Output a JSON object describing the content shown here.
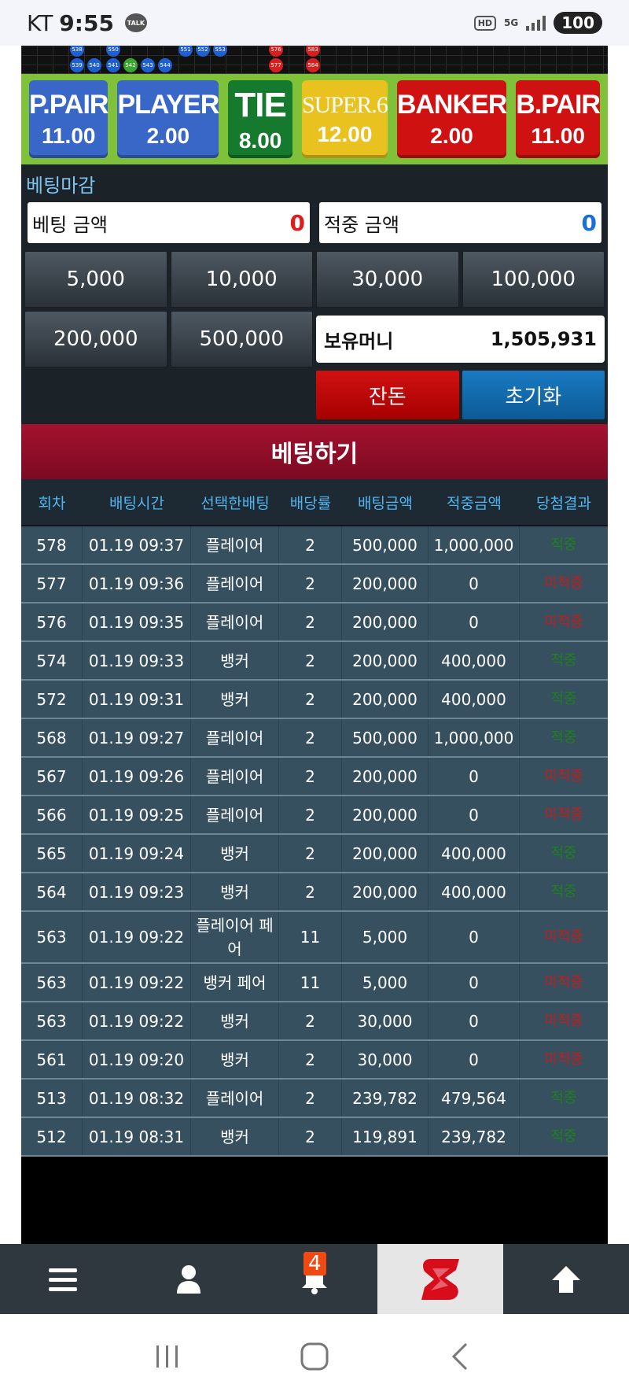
{
  "status_bar": {
    "carrier": "KT",
    "time": "9:55",
    "talk_label": "TALK",
    "hd_label": "HD",
    "network_label": "5G",
    "battery": "100"
  },
  "scoreboard": {
    "top_numbers": [
      "538",
      "550",
      "551",
      "552",
      "553",
      "576",
      "583"
    ],
    "bottom_numbers": [
      "539",
      "540",
      "541",
      "542",
      "543",
      "544",
      "577",
      "584"
    ]
  },
  "bet_options": [
    {
      "label": "P.PAIR",
      "odds": "11.00",
      "color": "#3867c8"
    },
    {
      "label": "PLAYER",
      "odds": "2.00",
      "color": "#3867c8"
    },
    {
      "label": "TIE",
      "odds": "8.00",
      "color": "#157a2d"
    },
    {
      "label": "SUPER.6",
      "odds": "12.00",
      "color": "#e9c21f"
    },
    {
      "label": "BANKER",
      "odds": "2.00",
      "color": "#cf1111"
    },
    {
      "label": "B.PAIR",
      "odds": "11.00",
      "color": "#cf1111"
    }
  ],
  "control": {
    "title": "베팅마감",
    "bet_amount_label": "베팅 금액",
    "bet_amount_value": "0",
    "win_amount_label": "적중 금액",
    "win_amount_value": "0",
    "chips": [
      "5,000",
      "10,000",
      "30,000",
      "100,000",
      "200,000",
      "500,000"
    ],
    "balance_label": "보유머니",
    "balance_value": "1,505,931",
    "change_label": "잔돈",
    "reset_label": "초기화"
  },
  "submit_label": "베팅하기",
  "table": {
    "headers": [
      "회차",
      "배팅시간",
      "선택한배팅",
      "배당률",
      "배팅금액",
      "적중금액",
      "당첨결과"
    ],
    "rows": [
      {
        "round": "578",
        "time": "01.19 09:37",
        "choice": "플레이어",
        "odds": "2",
        "bet": "500,000",
        "win": "1,000,000",
        "result": "적중",
        "won": true
      },
      {
        "round": "577",
        "time": "01.19 09:36",
        "choice": "플레이어",
        "odds": "2",
        "bet": "200,000",
        "win": "0",
        "result": "미적중",
        "won": false
      },
      {
        "round": "576",
        "time": "01.19 09:35",
        "choice": "플레이어",
        "odds": "2",
        "bet": "200,000",
        "win": "0",
        "result": "미적중",
        "won": false
      },
      {
        "round": "574",
        "time": "01.19 09:33",
        "choice": "뱅커",
        "odds": "2",
        "bet": "200,000",
        "win": "400,000",
        "result": "적중",
        "won": true
      },
      {
        "round": "572",
        "time": "01.19 09:31",
        "choice": "뱅커",
        "odds": "2",
        "bet": "200,000",
        "win": "400,000",
        "result": "적중",
        "won": true
      },
      {
        "round": "568",
        "time": "01.19 09:27",
        "choice": "플레이어",
        "odds": "2",
        "bet": "500,000",
        "win": "1,000,000",
        "result": "적중",
        "won": true
      },
      {
        "round": "567",
        "time": "01.19 09:26",
        "choice": "플레이어",
        "odds": "2",
        "bet": "200,000",
        "win": "0",
        "result": "미적중",
        "won": false
      },
      {
        "round": "566",
        "time": "01.19 09:25",
        "choice": "플레이어",
        "odds": "2",
        "bet": "200,000",
        "win": "0",
        "result": "미적중",
        "won": false
      },
      {
        "round": "565",
        "time": "01.19 09:24",
        "choice": "뱅커",
        "odds": "2",
        "bet": "200,000",
        "win": "400,000",
        "result": "적중",
        "won": true
      },
      {
        "round": "564",
        "time": "01.19 09:23",
        "choice": "뱅커",
        "odds": "2",
        "bet": "200,000",
        "win": "400,000",
        "result": "적중",
        "won": true
      },
      {
        "round": "563",
        "time": "01.19 09:22",
        "choice": "플레이어 페어",
        "odds": "11",
        "bet": "5,000",
        "win": "0",
        "result": "미적중",
        "won": false
      },
      {
        "round": "563",
        "time": "01.19 09:22",
        "choice": "뱅커 페어",
        "odds": "11",
        "bet": "5,000",
        "win": "0",
        "result": "미적중",
        "won": false
      },
      {
        "round": "563",
        "time": "01.19 09:22",
        "choice": "뱅커",
        "odds": "2",
        "bet": "30,000",
        "win": "0",
        "result": "미적중",
        "won": false
      },
      {
        "round": "561",
        "time": "01.19 09:20",
        "choice": "뱅커",
        "odds": "2",
        "bet": "30,000",
        "win": "0",
        "result": "미적중",
        "won": false
      },
      {
        "round": "513",
        "time": "01.19 08:32",
        "choice": "플레이어",
        "odds": "2",
        "bet": "239,782",
        "win": "479,564",
        "result": "적중",
        "won": true
      },
      {
        "round": "512",
        "time": "01.19 08:31",
        "choice": "뱅커",
        "odds": "2",
        "bet": "119,891",
        "win": "239,782",
        "result": "적중",
        "won": true
      }
    ]
  },
  "bottom_nav": {
    "items": [
      "menu-icon",
      "user-icon",
      "bell-icon",
      "logo",
      "arrow-up-icon"
    ],
    "notification_count": "4"
  },
  "system_nav": [
    "recent-apps-icon",
    "home-icon",
    "back-icon"
  ]
}
